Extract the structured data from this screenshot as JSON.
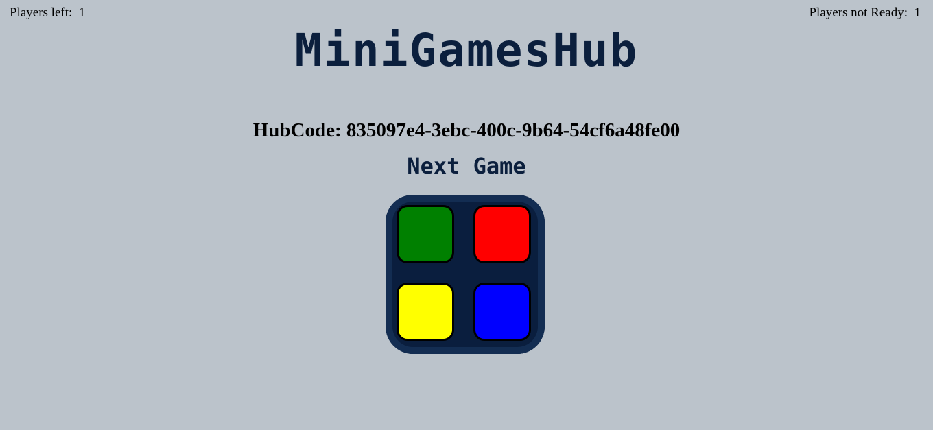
{
  "status": {
    "players_left_label": "Players left:",
    "players_left_value": "1",
    "players_not_ready_label": "Players not Ready:",
    "players_not_ready_value": "1"
  },
  "header": {
    "title": "MiniGamesHub"
  },
  "hub": {
    "code_label": "HubCode:",
    "code_value": "835097e4-3ebc-400c-9b64-54cf6a48fe00"
  },
  "next_game": {
    "heading": "Next Game",
    "icon": "simon-says-icon",
    "pad_colors": {
      "top_left": "#008000",
      "top_right": "#ff0000",
      "bottom_left": "#ffff00",
      "bottom_right": "#0000ff"
    }
  }
}
